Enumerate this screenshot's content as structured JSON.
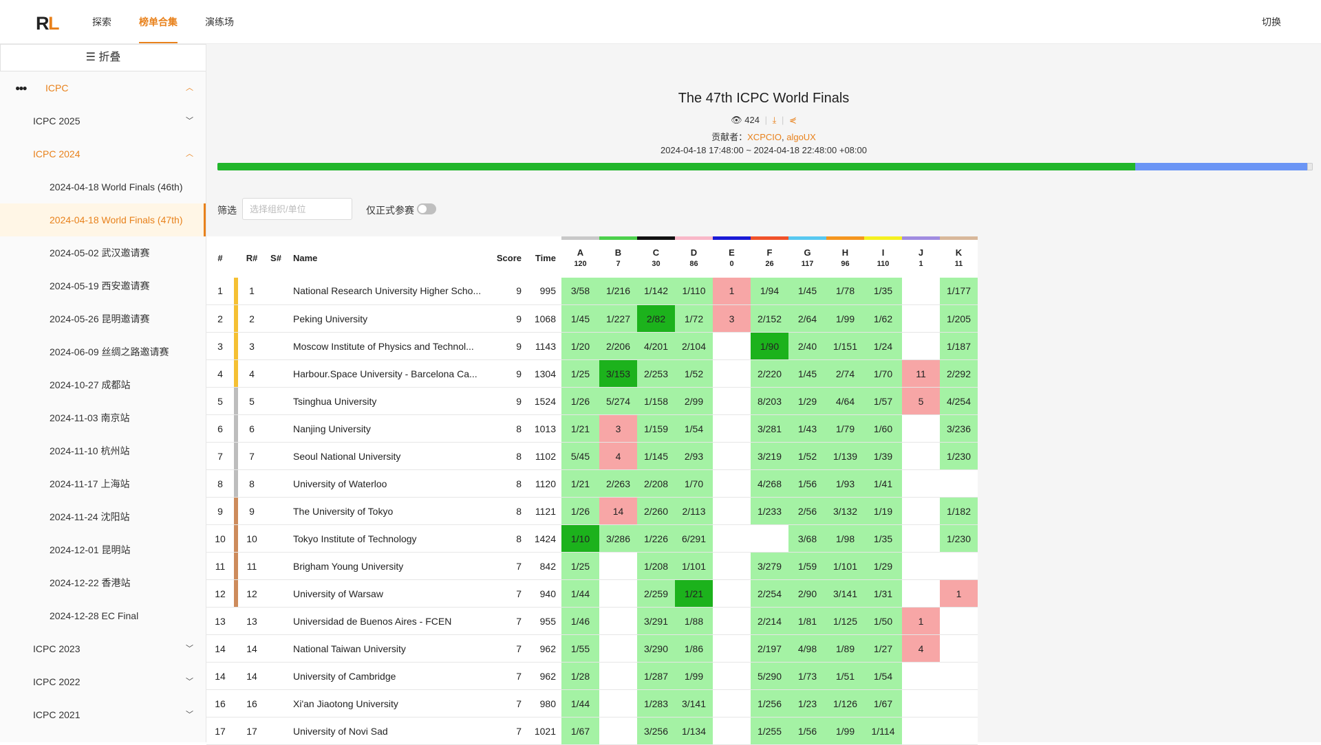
{
  "nav": {
    "items": [
      "探索",
      "榜单合集",
      "演练场"
    ],
    "active_index": 1,
    "switch_label": "切换"
  },
  "sidebar": {
    "fold_label": "折叠",
    "root": {
      "label": "ICPC",
      "icon": "icpc-balloons-icon",
      "expanded": true
    },
    "groups": [
      {
        "label": "ICPC 2025",
        "expanded": false
      },
      {
        "label": "ICPC 2024",
        "expanded": true,
        "children": [
          "2024-04-18 World Finals (46th)",
          "2024-04-18 World Finals (47th)",
          "2024-05-02 武汉邀请赛",
          "2024-05-19 西安邀请赛",
          "2024-05-26 昆明邀请赛",
          "2024-06-09 丝绸之路邀请赛",
          "2024-10-27 成都站",
          "2024-11-03 南京站",
          "2024-11-10 杭州站",
          "2024-11-17 上海站",
          "2024-11-24 沈阳站",
          "2024-12-01 昆明站",
          "2024-12-22 香港站",
          "2024-12-28 EC Final"
        ],
        "selected_index": 1
      },
      {
        "label": "ICPC 2023",
        "expanded": false
      },
      {
        "label": "ICPC 2022",
        "expanded": false
      },
      {
        "label": "ICPC 2021",
        "expanded": false
      }
    ]
  },
  "contest": {
    "title": "The 47th ICPC World Finals",
    "views": "424",
    "contrib_prefix": "贡献者：",
    "contributors": [
      "XCPCIO",
      "algoUX"
    ],
    "time_range": "2024-04-18 17:48:00 ~ 2024-04-18 22:48:00 +08:00",
    "progress": 0.838
  },
  "filter": {
    "label": "筛选",
    "placeholder": "选择组织/单位",
    "official_label": "仅正式参赛",
    "official_only": false
  },
  "colors": {
    "accent": "#e8811b",
    "accepted": "#a4f2a4",
    "first_blood": "#1cb21c",
    "wrong": "#f7a6a6",
    "progress_done": "#22b62b",
    "progress_rest": "#6b95f5",
    "gold": "#f5c033",
    "silver": "#bdbdbd",
    "bronze": "#cd8b5c"
  },
  "table": {
    "headers": {
      "rank": "#",
      "r_rank": "R#",
      "s_rank": "S#",
      "name": "Name",
      "score": "Score",
      "time": "Time"
    },
    "problems": [
      {
        "label": "A",
        "count": "120",
        "color": "#c8c8c8"
      },
      {
        "label": "B",
        "count": "7",
        "color": "#4cd04c"
      },
      {
        "label": "C",
        "count": "30",
        "color": "#111111"
      },
      {
        "label": "D",
        "count": "86",
        "color": "#f9b8c8"
      },
      {
        "label": "E",
        "count": "0",
        "color": "#1a1ad6"
      },
      {
        "label": "F",
        "count": "26",
        "color": "#f0522a"
      },
      {
        "label": "G",
        "count": "117",
        "color": "#58c8f0"
      },
      {
        "label": "H",
        "count": "96",
        "color": "#f5961e"
      },
      {
        "label": "I",
        "count": "110",
        "color": "#f5f020"
      },
      {
        "label": "J",
        "count": "1",
        "color": "#a08ce0"
      },
      {
        "label": "K",
        "count": "11",
        "color": "#d8b89a"
      }
    ],
    "rows": [
      {
        "rank": "1",
        "rrank": "1",
        "medal": "gold",
        "name": "National Research University Higher Scho...",
        "score": "9",
        "time": "995",
        "cells": [
          [
            "3/58",
            "ac"
          ],
          [
            "1/216",
            "ac"
          ],
          [
            "1/142",
            "ac"
          ],
          [
            "1/110",
            "ac"
          ],
          [
            "1",
            "wa"
          ],
          [
            "1/94",
            "ac"
          ],
          [
            "1/45",
            "ac"
          ],
          [
            "1/78",
            "ac"
          ],
          [
            "1/35",
            "ac"
          ],
          [
            "",
            ""
          ],
          [
            "1/177",
            "ac"
          ]
        ]
      },
      {
        "rank": "2",
        "rrank": "2",
        "medal": "gold",
        "name": "Peking University",
        "score": "9",
        "time": "1068",
        "cells": [
          [
            "1/45",
            "ac"
          ],
          [
            "1/227",
            "ac"
          ],
          [
            "2/82",
            "fb"
          ],
          [
            "1/72",
            "ac"
          ],
          [
            "3",
            "wa"
          ],
          [
            "2/152",
            "ac"
          ],
          [
            "2/64",
            "ac"
          ],
          [
            "1/99",
            "ac"
          ],
          [
            "1/62",
            "ac"
          ],
          [
            "",
            ""
          ],
          [
            "1/205",
            "ac"
          ]
        ]
      },
      {
        "rank": "3",
        "rrank": "3",
        "medal": "gold",
        "name": "Moscow Institute of Physics and Technol...",
        "score": "9",
        "time": "1143",
        "cells": [
          [
            "1/20",
            "ac"
          ],
          [
            "2/206",
            "ac"
          ],
          [
            "4/201",
            "ac"
          ],
          [
            "2/104",
            "ac"
          ],
          [
            "",
            ""
          ],
          [
            "1/90",
            "fb"
          ],
          [
            "2/40",
            "ac"
          ],
          [
            "1/151",
            "ac"
          ],
          [
            "1/24",
            "ac"
          ],
          [
            "",
            ""
          ],
          [
            "1/187",
            "ac"
          ]
        ]
      },
      {
        "rank": "4",
        "rrank": "4",
        "medal": "gold",
        "name": "Harbour.Space University - Barcelona Ca...",
        "score": "9",
        "time": "1304",
        "cells": [
          [
            "1/25",
            "ac"
          ],
          [
            "3/153",
            "fb"
          ],
          [
            "2/253",
            "ac"
          ],
          [
            "1/52",
            "ac"
          ],
          [
            "",
            ""
          ],
          [
            "2/220",
            "ac"
          ],
          [
            "1/45",
            "ac"
          ],
          [
            "2/74",
            "ac"
          ],
          [
            "1/70",
            "ac"
          ],
          [
            "11",
            "wa"
          ],
          [
            "2/292",
            "ac"
          ]
        ]
      },
      {
        "rank": "5",
        "rrank": "5",
        "medal": "silver",
        "name": "Tsinghua University",
        "score": "9",
        "time": "1524",
        "cells": [
          [
            "1/26",
            "ac"
          ],
          [
            "5/274",
            "ac"
          ],
          [
            "1/158",
            "ac"
          ],
          [
            "2/99",
            "ac"
          ],
          [
            "",
            ""
          ],
          [
            "8/203",
            "ac"
          ],
          [
            "1/29",
            "ac"
          ],
          [
            "4/64",
            "ac"
          ],
          [
            "1/57",
            "ac"
          ],
          [
            "5",
            "wa"
          ],
          [
            "4/254",
            "ac"
          ]
        ]
      },
      {
        "rank": "6",
        "rrank": "6",
        "medal": "silver",
        "name": "Nanjing University",
        "score": "8",
        "time": "1013",
        "cells": [
          [
            "1/21",
            "ac"
          ],
          [
            "3",
            "wa"
          ],
          [
            "1/159",
            "ac"
          ],
          [
            "1/54",
            "ac"
          ],
          [
            "",
            ""
          ],
          [
            "3/281",
            "ac"
          ],
          [
            "1/43",
            "ac"
          ],
          [
            "1/79",
            "ac"
          ],
          [
            "1/60",
            "ac"
          ],
          [
            "",
            ""
          ],
          [
            "3/236",
            "ac"
          ]
        ]
      },
      {
        "rank": "7",
        "rrank": "7",
        "medal": "silver",
        "name": "Seoul National University",
        "score": "8",
        "time": "1102",
        "cells": [
          [
            "5/45",
            "ac"
          ],
          [
            "4",
            "wa"
          ],
          [
            "1/145",
            "ac"
          ],
          [
            "2/93",
            "ac"
          ],
          [
            "",
            ""
          ],
          [
            "3/219",
            "ac"
          ],
          [
            "1/52",
            "ac"
          ],
          [
            "1/139",
            "ac"
          ],
          [
            "1/39",
            "ac"
          ],
          [
            "",
            ""
          ],
          [
            "1/230",
            "ac"
          ]
        ]
      },
      {
        "rank": "8",
        "rrank": "8",
        "medal": "silver",
        "name": "University of Waterloo",
        "score": "8",
        "time": "1120",
        "cells": [
          [
            "1/21",
            "ac"
          ],
          [
            "2/263",
            "ac"
          ],
          [
            "2/208",
            "ac"
          ],
          [
            "1/70",
            "ac"
          ],
          [
            "",
            ""
          ],
          [
            "4/268",
            "ac"
          ],
          [
            "1/56",
            "ac"
          ],
          [
            "1/93",
            "ac"
          ],
          [
            "1/41",
            "ac"
          ],
          [
            "",
            ""
          ],
          [
            "",
            ""
          ]
        ]
      },
      {
        "rank": "9",
        "rrank": "9",
        "medal": "bronze",
        "name": "The University of Tokyo",
        "score": "8",
        "time": "1121",
        "cells": [
          [
            "1/26",
            "ac"
          ],
          [
            "14",
            "wa"
          ],
          [
            "2/260",
            "ac"
          ],
          [
            "2/113",
            "ac"
          ],
          [
            "",
            ""
          ],
          [
            "1/233",
            "ac"
          ],
          [
            "2/56",
            "ac"
          ],
          [
            "3/132",
            "ac"
          ],
          [
            "1/19",
            "ac"
          ],
          [
            "",
            ""
          ],
          [
            "1/182",
            "ac"
          ]
        ]
      },
      {
        "rank": "10",
        "rrank": "10",
        "medal": "bronze",
        "name": "Tokyo Institute of Technology",
        "score": "8",
        "time": "1424",
        "cells": [
          [
            "1/10",
            "fb"
          ],
          [
            "3/286",
            "ac"
          ],
          [
            "1/226",
            "ac"
          ],
          [
            "6/291",
            "ac"
          ],
          [
            "",
            ""
          ],
          [
            "",
            ""
          ],
          [
            "3/68",
            "ac"
          ],
          [
            "1/98",
            "ac"
          ],
          [
            "1/35",
            "ac"
          ],
          [
            "",
            ""
          ],
          [
            "1/230",
            "ac"
          ]
        ]
      },
      {
        "rank": "11",
        "rrank": "11",
        "medal": "bronze",
        "name": "Brigham Young University",
        "score": "7",
        "time": "842",
        "cells": [
          [
            "1/25",
            "ac"
          ],
          [
            "",
            ""
          ],
          [
            "1/208",
            "ac"
          ],
          [
            "1/101",
            "ac"
          ],
          [
            "",
            ""
          ],
          [
            "3/279",
            "ac"
          ],
          [
            "1/59",
            "ac"
          ],
          [
            "1/101",
            "ac"
          ],
          [
            "1/29",
            "ac"
          ],
          [
            "",
            ""
          ],
          [
            "",
            ""
          ]
        ]
      },
      {
        "rank": "12",
        "rrank": "12",
        "medal": "bronze",
        "name": "University of Warsaw",
        "score": "7",
        "time": "940",
        "cells": [
          [
            "1/44",
            "ac"
          ],
          [
            "",
            ""
          ],
          [
            "2/259",
            "ac"
          ],
          [
            "1/21",
            "fb"
          ],
          [
            "",
            ""
          ],
          [
            "2/254",
            "ac"
          ],
          [
            "2/90",
            "ac"
          ],
          [
            "3/141",
            "ac"
          ],
          [
            "1/31",
            "ac"
          ],
          [
            "",
            ""
          ],
          [
            "1",
            "wa"
          ]
        ]
      },
      {
        "rank": "13",
        "rrank": "13",
        "medal": "",
        "name": "Universidad de Buenos Aires - FCEN",
        "score": "7",
        "time": "955",
        "cells": [
          [
            "1/46",
            "ac"
          ],
          [
            "",
            ""
          ],
          [
            "3/291",
            "ac"
          ],
          [
            "1/88",
            "ac"
          ],
          [
            "",
            ""
          ],
          [
            "2/214",
            "ac"
          ],
          [
            "1/81",
            "ac"
          ],
          [
            "1/125",
            "ac"
          ],
          [
            "1/50",
            "ac"
          ],
          [
            "1",
            "wa"
          ],
          [
            "",
            ""
          ]
        ]
      },
      {
        "rank": "14",
        "rrank": "14",
        "medal": "",
        "name": "National Taiwan University",
        "score": "7",
        "time": "962",
        "cells": [
          [
            "1/55",
            "ac"
          ],
          [
            "",
            ""
          ],
          [
            "3/290",
            "ac"
          ],
          [
            "1/86",
            "ac"
          ],
          [
            "",
            ""
          ],
          [
            "2/197",
            "ac"
          ],
          [
            "4/98",
            "ac"
          ],
          [
            "1/89",
            "ac"
          ],
          [
            "1/27",
            "ac"
          ],
          [
            "4",
            "wa"
          ],
          [
            "",
            ""
          ]
        ]
      },
      {
        "rank": "14",
        "rrank": "14",
        "medal": "",
        "name": "University of Cambridge",
        "score": "7",
        "time": "962",
        "cells": [
          [
            "1/28",
            "ac"
          ],
          [
            "",
            ""
          ],
          [
            "1/287",
            "ac"
          ],
          [
            "1/99",
            "ac"
          ],
          [
            "",
            ""
          ],
          [
            "5/290",
            "ac"
          ],
          [
            "1/73",
            "ac"
          ],
          [
            "1/51",
            "ac"
          ],
          [
            "1/54",
            "ac"
          ],
          [
            "",
            ""
          ],
          [
            "",
            ""
          ]
        ]
      },
      {
        "rank": "16",
        "rrank": "16",
        "medal": "",
        "name": "Xi'an Jiaotong University",
        "score": "7",
        "time": "980",
        "cells": [
          [
            "1/44",
            "ac"
          ],
          [
            "",
            ""
          ],
          [
            "1/283",
            "ac"
          ],
          [
            "3/141",
            "ac"
          ],
          [
            "",
            ""
          ],
          [
            "1/256",
            "ac"
          ],
          [
            "1/23",
            "ac"
          ],
          [
            "1/126",
            "ac"
          ],
          [
            "1/67",
            "ac"
          ],
          [
            "",
            ""
          ],
          [
            "",
            ""
          ]
        ]
      },
      {
        "rank": "17",
        "rrank": "17",
        "medal": "",
        "name": "University of Novi Sad",
        "score": "7",
        "time": "1021",
        "cells": [
          [
            "1/67",
            "ac"
          ],
          [
            "",
            ""
          ],
          [
            "3/256",
            "ac"
          ],
          [
            "1/134",
            "ac"
          ],
          [
            "",
            ""
          ],
          [
            "1/255",
            "ac"
          ],
          [
            "1/56",
            "ac"
          ],
          [
            "1/99",
            "ac"
          ],
          [
            "1/114",
            "ac"
          ],
          [
            "",
            ""
          ],
          [
            "",
            ""
          ]
        ]
      }
    ]
  }
}
